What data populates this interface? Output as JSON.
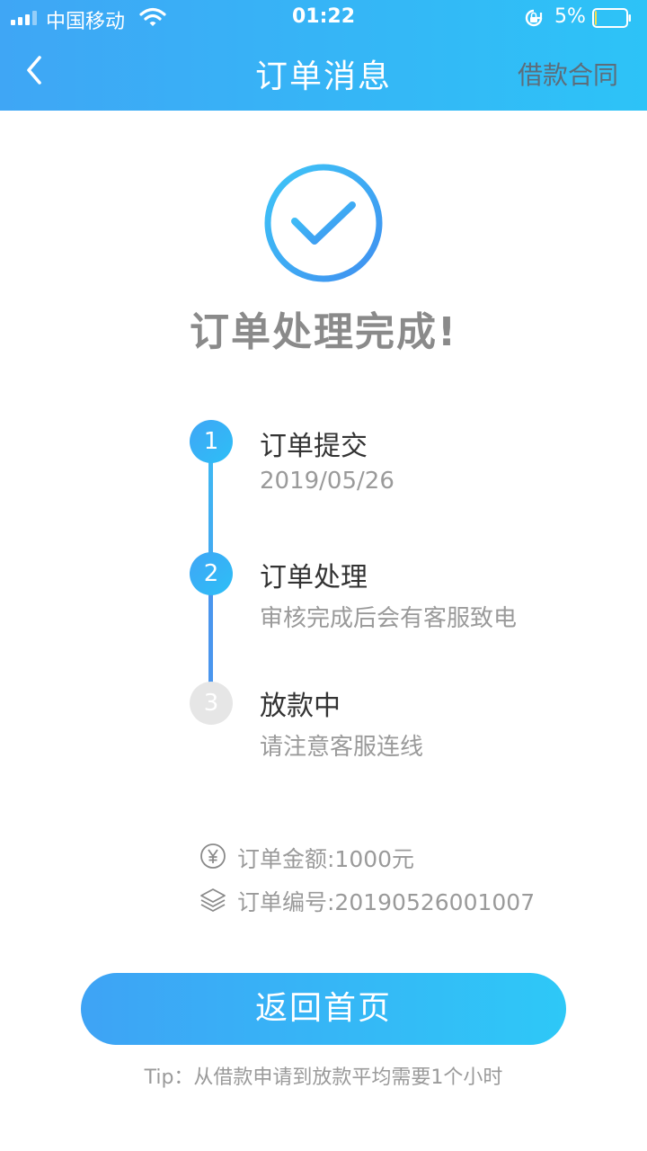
{
  "status_bar": {
    "carrier": "中国移动",
    "time": "01:22",
    "battery_percent": "5%",
    "battery_level": 0.05
  },
  "header": {
    "title": "订单消息",
    "right_link": "借款合同"
  },
  "result": {
    "headline": "订单处理完成!"
  },
  "steps": [
    {
      "number": "1",
      "title": "订单提交",
      "subtitle": "2019/05/26",
      "state": "done"
    },
    {
      "number": "2",
      "title": "订单处理",
      "subtitle": "审核完成后会有客服致电",
      "state": "done"
    },
    {
      "number": "3",
      "title": "放款中",
      "subtitle": "请注意客服连线",
      "state": "pending"
    }
  ],
  "order_info": {
    "amount": "订单金额:1000元",
    "order_number": "订单编号:20190526001007"
  },
  "actions": {
    "home_button": "返回首页",
    "tip": "Tip：从借款申请到放款平均需要1个小时"
  },
  "colors": {
    "accent": "#3fa6f5",
    "accent_light": "#2dc3f7",
    "pending": "#e6e6e6"
  },
  "icons": [
    "signal-icon",
    "wifi-icon",
    "lock-rotation-icon",
    "battery-icon",
    "back-chevron-icon",
    "success-check-icon",
    "yen-icon",
    "layers-icon"
  ]
}
